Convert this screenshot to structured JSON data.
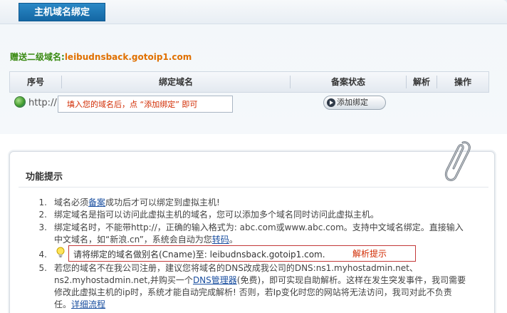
{
  "header": {
    "title": "主机域名绑定"
  },
  "bonus": {
    "label": "赠送二级域名:",
    "domain": "leibudnsback.gotoip1.com"
  },
  "table": {
    "columns": [
      "序号",
      "绑定域名",
      "备案状态",
      "解析",
      "操作"
    ]
  },
  "bind_row": {
    "prefix": "http://",
    "input_placeholder": "填入您的域名后，点 “添加绑定” 即可",
    "add_button": "添加绑定"
  },
  "tips": {
    "heading": "功能提示",
    "item1": {
      "num": "1.",
      "pre": "域名必须",
      "link": "备案",
      "post": "成功后才可以绑定到虚拟主机!"
    },
    "item2": {
      "num": "2.",
      "text": "绑定域名是指可以访问此虚拟主机的域名，您可以添加多个域名同时访问此虚拟主机。"
    },
    "item3": {
      "num": "3.",
      "line1": "绑定域名时，不能带http://，正确的输入格式为: abc.com或www.abc.com。支持中文域名绑定。直接输入",
      "line2_pre": "中文域名，如“新浪.cn”，系统会自动为您",
      "line2_link": "转码",
      "line2_post": "。"
    },
    "item4": {
      "num": "4.",
      "text": "请将绑定的域名做别名(Cname)至: leibudnsback.gotoip1.com.",
      "hint": "解析提示"
    },
    "item5": {
      "num": "5.",
      "line1": "若您的域名不在我公司注册，建议您将域名的DNS改成我公司的DNS:ns1.myhostadmin.net、",
      "line2_pre": "ns2.myhostadmin.net,并购买一个",
      "line2_link": "DNS管理器",
      "line2_post": "(免费)，即可实现自助解析。这样在发生突发事件，我司需要",
      "line3": "修改此虚拟主机的ip时，系统才能自动完成解析!  否则，若Ip变化时您的网站将无法访问，我司对此不负责",
      "line4_pre": "任。",
      "line4_link": "详细流程"
    }
  }
}
